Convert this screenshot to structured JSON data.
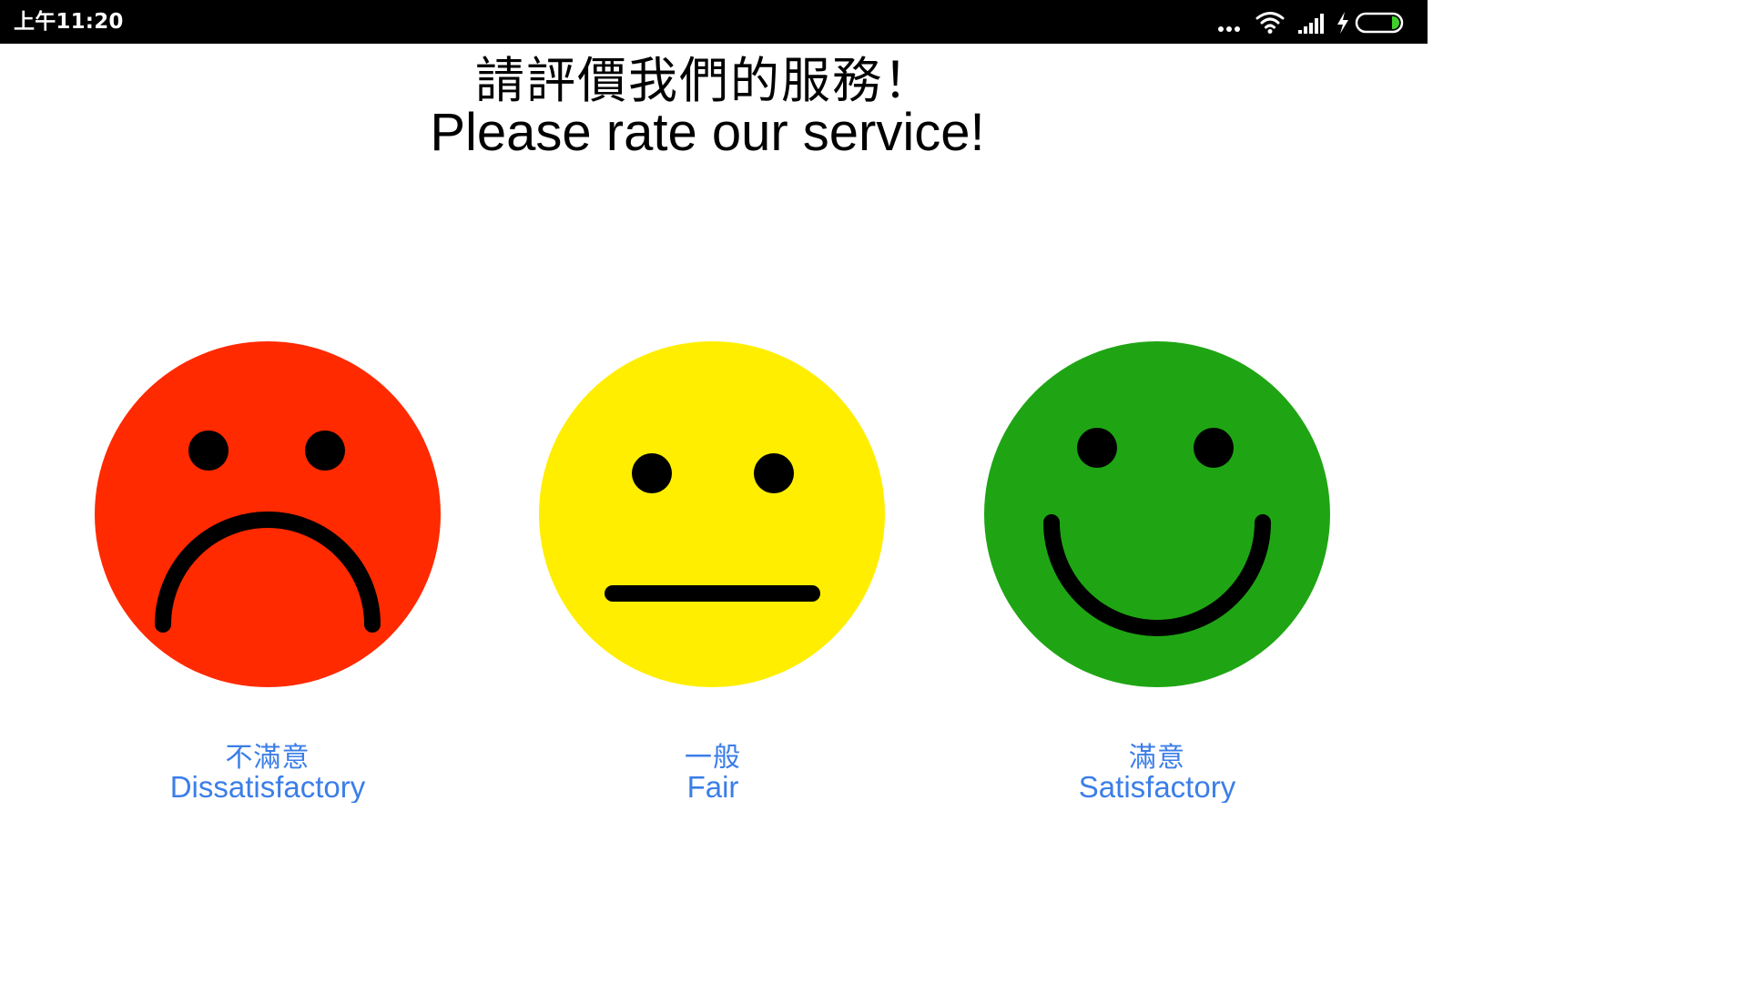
{
  "status_bar": {
    "time": "上午11:20",
    "icons": [
      "more-dots-icon",
      "wifi-icon",
      "cellular-signal-icon",
      "charging-bolt-icon",
      "battery-icon"
    ]
  },
  "header": {
    "title_zh": "請評價我們的服務！",
    "title_en": "Please rate our service!"
  },
  "ratings": [
    {
      "id": "dissatisfactory",
      "label_zh": "不滿意",
      "label_en": "Dissatisfactory",
      "color": "#ff2a00",
      "expression": "sad"
    },
    {
      "id": "fair",
      "label_zh": "一般",
      "label_en": "Fair",
      "color": "#ffee00",
      "expression": "neutral"
    },
    {
      "id": "satisfactory",
      "label_zh": "滿意",
      "label_en": "Satisfactory",
      "color": "#1fa514",
      "expression": "happy"
    }
  ],
  "colors": {
    "label_text": "#3b7ee8",
    "status_bar_bg": "#000000",
    "battery_fill": "#3fd12a"
  }
}
